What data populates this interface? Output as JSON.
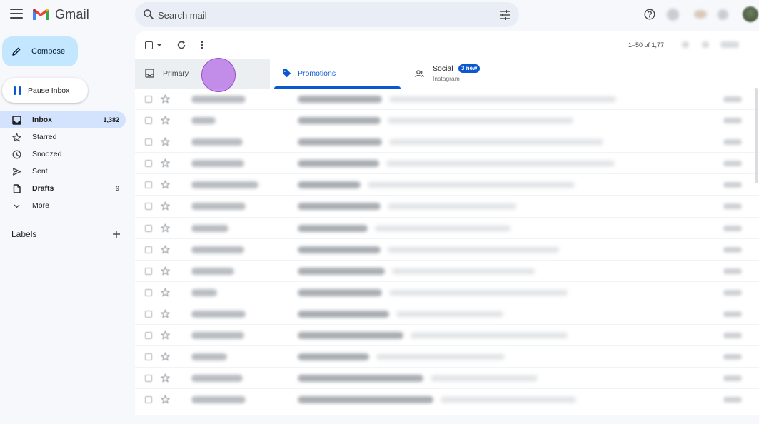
{
  "app": {
    "name": "Gmail"
  },
  "search": {
    "placeholder": "Search mail"
  },
  "sidebar": {
    "compose_label": "Compose",
    "pause_label": "Pause Inbox",
    "items": [
      {
        "label": "Inbox",
        "count": "1,382",
        "icon": "inbox-icon",
        "active": true,
        "bold": true
      },
      {
        "label": "Starred",
        "count": "",
        "icon": "star-icon",
        "active": false,
        "bold": false
      },
      {
        "label": "Snoozed",
        "count": "",
        "icon": "clock-icon",
        "active": false,
        "bold": false
      },
      {
        "label": "Sent",
        "count": "",
        "icon": "send-icon",
        "active": false,
        "bold": false
      },
      {
        "label": "Drafts",
        "count": "9",
        "icon": "draft-icon",
        "active": false,
        "bold": true
      },
      {
        "label": "More",
        "count": "",
        "icon": "chevron-down-icon",
        "active": false,
        "bold": false
      }
    ],
    "labels_title": "Labels"
  },
  "toolbar": {
    "pager_text": "1–50 of 1,77"
  },
  "tabs": [
    {
      "label": "Primary",
      "icon": "inbox-icon"
    },
    {
      "label": "Promotions",
      "icon": "tag-icon"
    },
    {
      "label": "Social",
      "icon": "people-icon",
      "badge": "3 new",
      "sub": "Instagram"
    }
  ],
  "colors": {
    "accent": "#0b57d0",
    "compose_bg": "#c2e7ff",
    "active_nav": "#d3e3fd",
    "cursor": "#b266e6"
  }
}
